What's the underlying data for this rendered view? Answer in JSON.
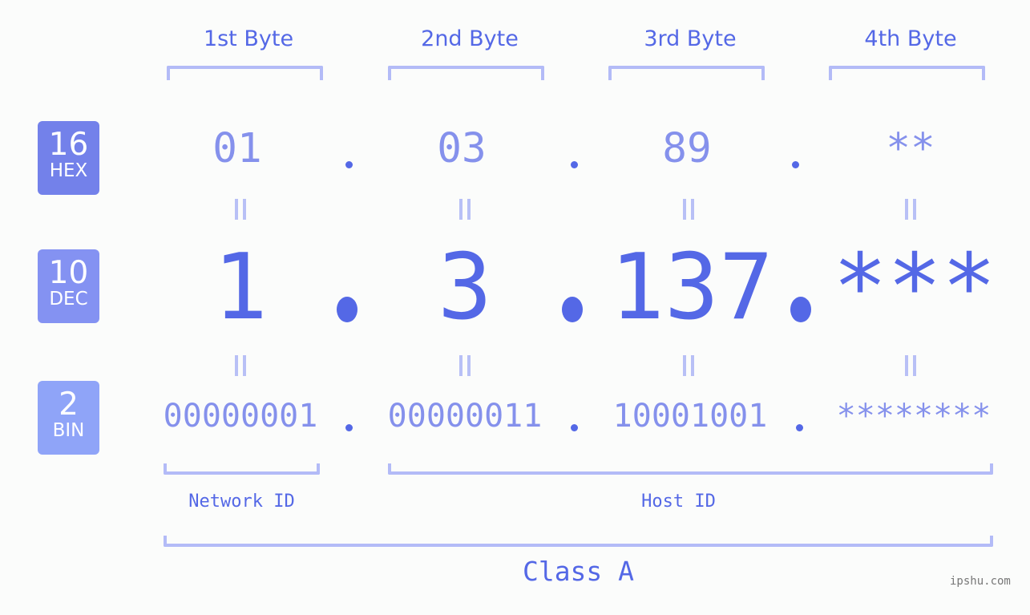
{
  "header": {
    "bytes": [
      "1st Byte",
      "2nd Byte",
      "3rd Byte",
      "4th Byte"
    ]
  },
  "badges": {
    "hex": {
      "num": "16",
      "label": "HEX",
      "color": "#7381ea"
    },
    "dec": {
      "num": "10",
      "label": "DEC",
      "color": "#8492f2"
    },
    "bin": {
      "num": "2",
      "label": "BIN",
      "color": "#8fa4f8"
    }
  },
  "rows": {
    "hex": [
      "01",
      "03",
      "89",
      "**"
    ],
    "dec": [
      "1",
      "3",
      "137",
      "***"
    ],
    "bin": [
      "00000001",
      "00000011",
      "10001001",
      "********"
    ]
  },
  "segments": {
    "network": "Network ID",
    "host": "Host ID",
    "class": "Class A"
  },
  "watermark": "ipshu.com",
  "colors": {
    "accent": "#5468e6",
    "light": "#8591ec",
    "bracket": "#b3bbf7",
    "background": "#fbfcfb"
  }
}
